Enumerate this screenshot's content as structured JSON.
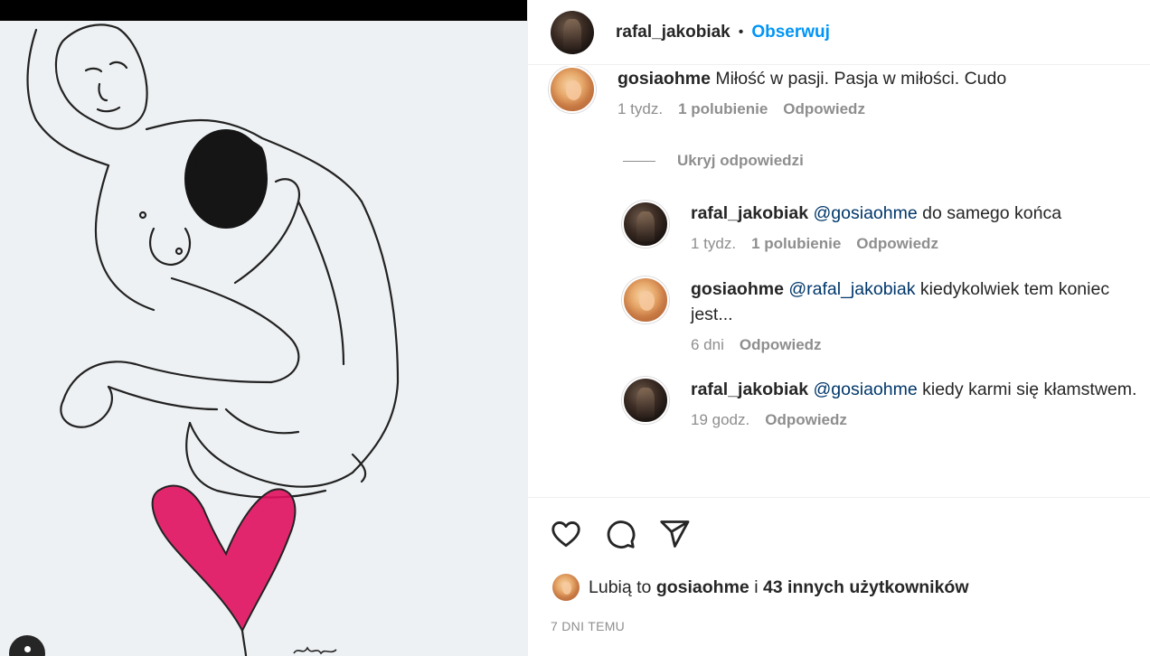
{
  "header": {
    "username": "rafal_jakobiak",
    "separator": "•",
    "follow_label": "Obserwuj"
  },
  "comments": [
    {
      "username": "gosiaohme",
      "text": "Miłość w pasji. Pasja w miłości. Cudo",
      "time": "1 tydz.",
      "likes": "1 polubienie",
      "reply_label": "Odpowiedz"
    }
  ],
  "hide_replies_label": "Ukryj odpowiedzi",
  "replies": [
    {
      "username": "rafal_jakobiak",
      "mention": "@gosiaohme",
      "text": "do samego końca",
      "time": "1 tydz.",
      "likes": "1 polubienie",
      "reply_label": "Odpowiedz"
    },
    {
      "username": "gosiaohme",
      "mention": "@rafal_jakobiak",
      "text": "kiedykolwiek tem koniec jest...",
      "time": "6 dni",
      "reply_label": "Odpowiedz"
    },
    {
      "username": "rafal_jakobiak",
      "mention": "@gosiaohme",
      "text": "kiedy karmi się kłamstwem.",
      "time": "19 godz.",
      "reply_label": "Odpowiedz"
    }
  ],
  "likes_summary": {
    "prefix": "Lubią to",
    "user": "gosiaohme",
    "joiner": "i",
    "others": "43 innych użytkowników"
  },
  "post_date": "7 DNI TEMU",
  "icons": {
    "like": "heart-icon",
    "comment": "comment-icon",
    "share": "share-icon",
    "user_tag": "user-tag-icon"
  },
  "colors": {
    "accent": "#0095f6",
    "mention": "#00376b",
    "muted": "#8e8e8e",
    "heart_art": "#e0105f"
  }
}
